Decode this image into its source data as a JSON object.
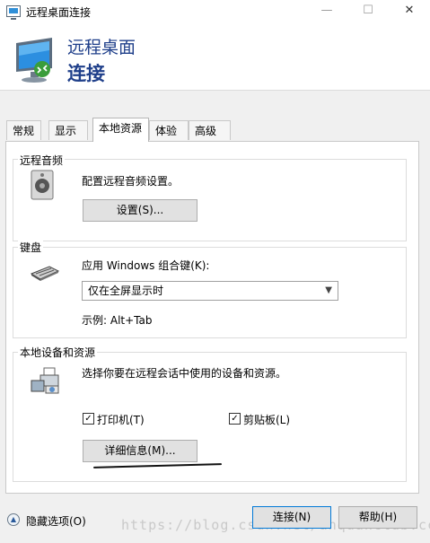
{
  "window": {
    "title": "远程桌面连接",
    "controls": [
      "—",
      "☐",
      "✕"
    ]
  },
  "header": {
    "line1": "远程桌面",
    "line2": "连接"
  },
  "tabs": [
    {
      "label": "常规"
    },
    {
      "label": "显示"
    },
    {
      "label": "本地资源"
    },
    {
      "label": "体验"
    },
    {
      "label": "高级"
    }
  ],
  "audio": {
    "legend": "远程音频",
    "description": "配置远程音频设置。",
    "button_label": "设置(S)..."
  },
  "keyboard": {
    "legend": "键盘",
    "label": "应用 Windows 组合键(K):",
    "selected": "仅在全屏显示时",
    "example": "示例: Alt+Tab"
  },
  "devices": {
    "legend": "本地设备和资源",
    "description": "选择你要在远程会话中使用的设备和资源。",
    "printers_label": "打印机(T)",
    "clipboard_label": "剪贴板(L)",
    "details_button": "详细信息(M)..."
  },
  "footer": {
    "hide_options": "隐藏选项(O)",
    "connect": "连接(N)",
    "help": "帮助(H)"
  },
  "watermark": "https://blog.csdn.net/anquanclub.cc"
}
